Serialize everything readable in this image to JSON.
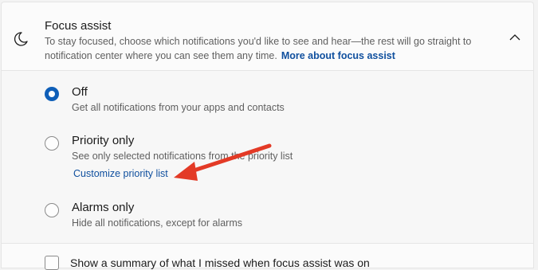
{
  "header": {
    "title": "Focus assist",
    "description": "To stay focused, choose which notifications you'd like to see and hear—the rest will go straight to notification center where you can see them any time.",
    "more_link": "More about focus assist",
    "icon": "moon-icon",
    "collapse_icon": "chevron-up-icon"
  },
  "options": [
    {
      "title": "Off",
      "description": "Get all notifications from your apps and contacts",
      "selected": true
    },
    {
      "title": "Priority only",
      "description": "See only selected notifications from the priority list",
      "link": "Customize priority list",
      "selected": false
    },
    {
      "title": "Alarms only",
      "description": "Hide all notifications, except for alarms",
      "selected": false
    }
  ],
  "summary": {
    "label": "Show a summary of what I missed when focus assist was on",
    "checked": false
  },
  "annotation": {
    "type": "arrow",
    "color": "#e33a26"
  },
  "colors": {
    "accent": "#0f5fb8",
    "link": "#0f4f9e"
  }
}
